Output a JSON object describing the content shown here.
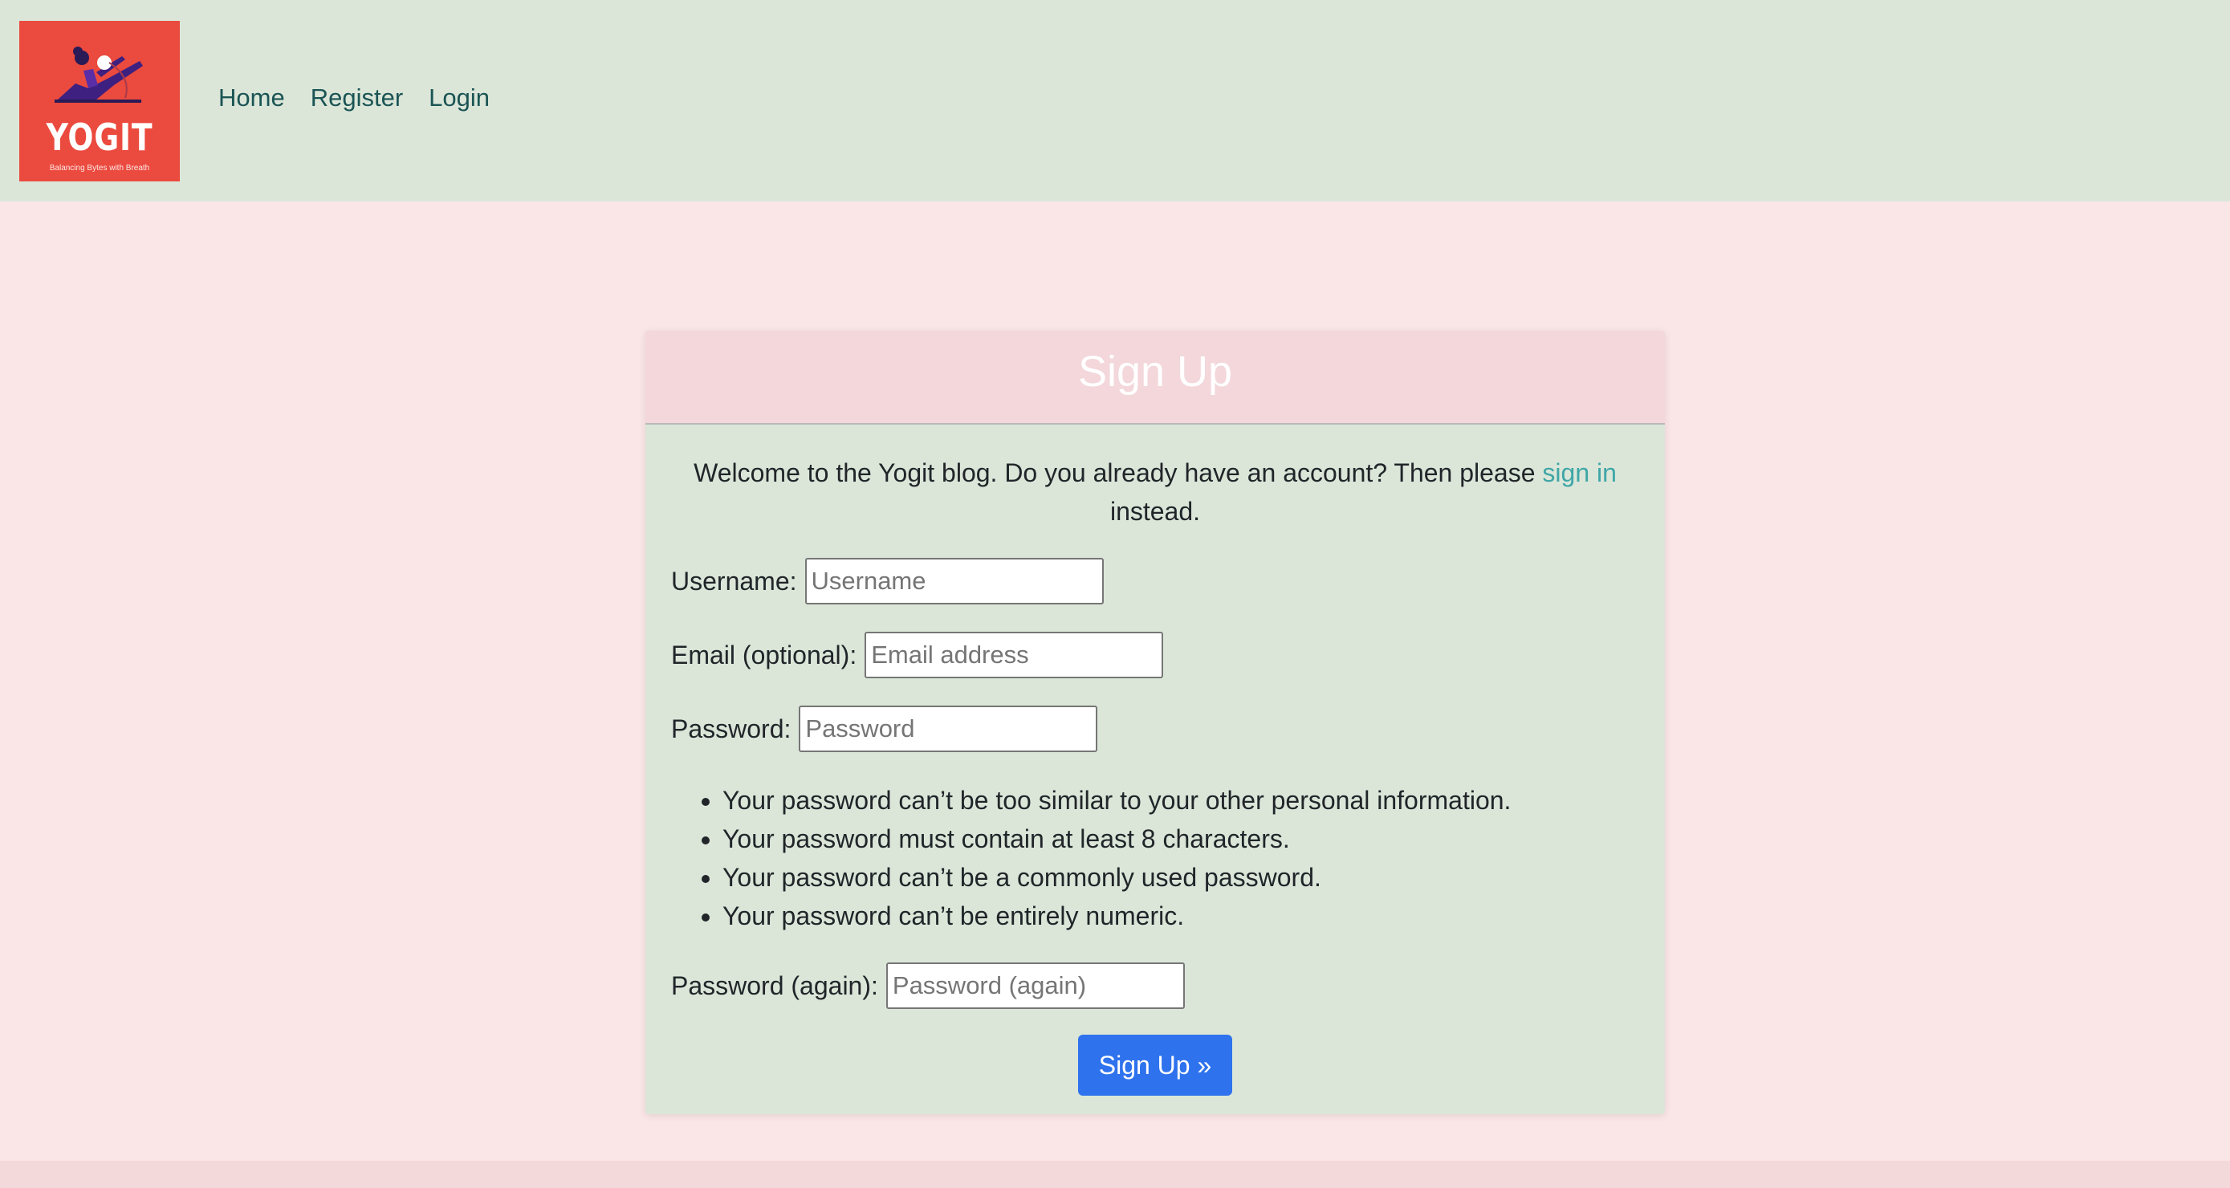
{
  "nav": {
    "logo": {
      "word": "YOGIT",
      "tagline": "Balancing Bytes with Breath",
      "bg_color": "#eb4a3e"
    },
    "links": [
      "Home",
      "Register",
      "Login"
    ]
  },
  "signup": {
    "title": "Sign Up",
    "intro_before": "Welcome to the Yogit blog. Do you already have an account? Then please ",
    "intro_link": "sign in",
    "intro_after": " instead.",
    "fields": [
      {
        "label": "Username:",
        "placeholder": "Username"
      },
      {
        "label": "Email (optional):",
        "placeholder": "Email address"
      },
      {
        "label": "Password:",
        "placeholder": "Password"
      },
      {
        "label": "Password (again):",
        "placeholder": "Password (again)"
      }
    ],
    "password_rules": [
      "Your password can’t be too similar to your other personal information.",
      "Your password must contain at least 8 characters.",
      "Your password can’t be a commonly used password.",
      "Your password can’t be entirely numeric."
    ],
    "submit_label": "Sign Up »"
  },
  "colors": {
    "page_bg": "#fbe6e7",
    "nav_bg": "#dbe6d9",
    "card_header_bg": "#f3d7db",
    "link": "#3fa6a6",
    "primary_button": "#2e72ed"
  }
}
